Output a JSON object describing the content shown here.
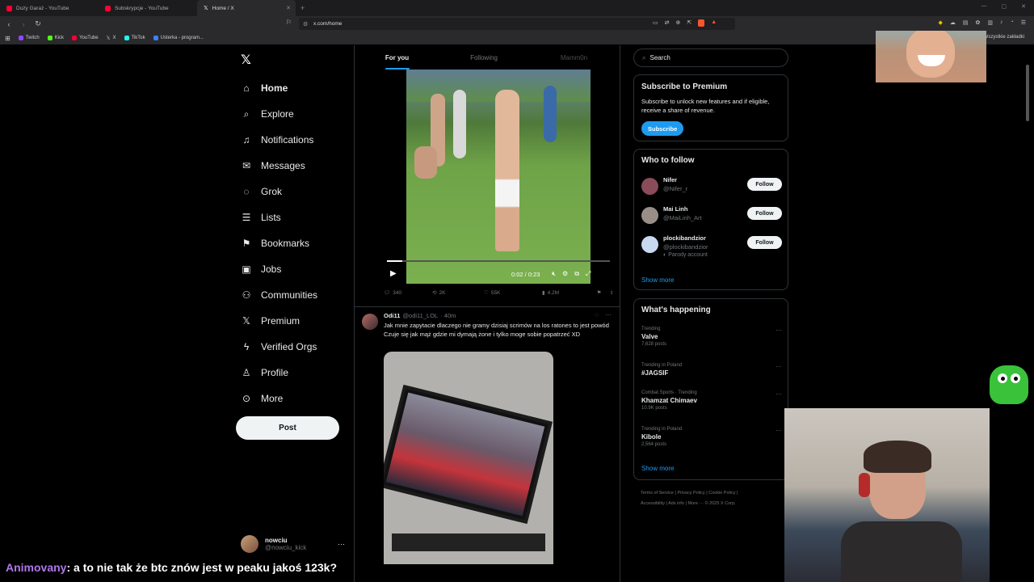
{
  "browser": {
    "tabs": [
      {
        "title": "Duży Garaż - YouTube",
        "color": "#ff0033"
      },
      {
        "title": "Subskrypcje - YouTube",
        "color": "#ff0033"
      },
      {
        "title": "Home / X",
        "color": "#ffffff"
      }
    ],
    "url": "x.com/home",
    "bookmarks": [
      "Twitch",
      "Kick",
      "YouTube",
      "X",
      "TikTok",
      "Usterka - program..."
    ],
    "bookmarks_right": "Wszystkie zakładki"
  },
  "sidebar": {
    "items": [
      {
        "label": "Home",
        "icon": "home-icon",
        "glyph": "⌂"
      },
      {
        "label": "Explore",
        "icon": "search-icon",
        "glyph": "⌕"
      },
      {
        "label": "Notifications",
        "icon": "bell-icon",
        "glyph": "♫"
      },
      {
        "label": "Messages",
        "icon": "envelope-icon",
        "glyph": "✉"
      },
      {
        "label": "Grok",
        "icon": "grok-icon",
        "glyph": "◌"
      },
      {
        "label": "Lists",
        "icon": "list-icon",
        "glyph": "☰"
      },
      {
        "label": "Bookmarks",
        "icon": "bookmark-icon",
        "glyph": "⚑"
      },
      {
        "label": "Jobs",
        "icon": "briefcase-icon",
        "glyph": "▣"
      },
      {
        "label": "Communities",
        "icon": "people-icon",
        "glyph": "⚇"
      },
      {
        "label": "Premium",
        "icon": "x-logo-icon",
        "glyph": "𝕏"
      },
      {
        "label": "Verified Orgs",
        "icon": "lightning-icon",
        "glyph": "ϟ"
      },
      {
        "label": "Profile",
        "icon": "person-icon",
        "glyph": "♙"
      },
      {
        "label": "More",
        "icon": "more-circle-icon",
        "glyph": "⊙"
      }
    ],
    "post_label": "Post",
    "profile": {
      "name": "nowciu",
      "handle": "@nowciu_kick"
    }
  },
  "feed": {
    "tabs": [
      "For you",
      "Following",
      "Mamm0n"
    ],
    "video": {
      "time": "0:02 / 0:23",
      "progress": 0.07
    },
    "actions": {
      "replies": "340",
      "reposts": "2K",
      "likes": "55K",
      "views": "4.2M"
    },
    "tweet2": {
      "name": "Odi11",
      "handle": "@odi11_LOL",
      "time": "· 40m",
      "line1": "Jak mnie zapytacie dlaczego nie gramy dzisiaj scrimów na los ratones to jest powód",
      "line2": "Czuje się jak mąż gdzie mi dymają żone i tylko moge sobie popatrzeć XD"
    }
  },
  "right": {
    "search_placeholder": "Search",
    "premium": {
      "title": "Subscribe to Premium",
      "text": "Subscribe to unlock new features and if eligible, receive a share of revenue.",
      "button": "Subscribe"
    },
    "follow": {
      "title": "Who to follow",
      "users": [
        {
          "name": "Nifer",
          "handle": "@Nifer_r",
          "note": "",
          "color": "#8a4b5a"
        },
        {
          "name": "Mai Linh",
          "handle": "@MaiLinh_Art",
          "note": "",
          "color": "#9a8f88"
        },
        {
          "name": "plockibandzior",
          "handle": "@plockibandzior",
          "note": "Parody account",
          "color": "#c8d8f0"
        }
      ],
      "button": "Follow",
      "show_more": "Show more"
    },
    "happening": {
      "title": "What's happening",
      "trends": [
        {
          "cat": "Trending",
          "topic": "Valve",
          "count": "7,628 posts"
        },
        {
          "cat": "Trending in Poland",
          "topic": "#JAGSIF",
          "count": ""
        },
        {
          "cat": "Combat Sports · Trending",
          "topic": "Khamzat Chimaev",
          "count": "10.9K posts"
        },
        {
          "cat": "Trending in Poland",
          "topic": "Kibole",
          "count": "2,564 posts"
        }
      ],
      "show_more": "Show more"
    },
    "footer": {
      "line1": "Terms of Service   |   Privacy Policy   |   Cookie Policy   |",
      "line2": "Accessibility   |   Ads info   |   More ···   © 2025 X Corp."
    }
  },
  "chat": {
    "user": "Animovany",
    "message": ": a to nie tak że btc znów jest w peaku jakoś 123k?"
  }
}
